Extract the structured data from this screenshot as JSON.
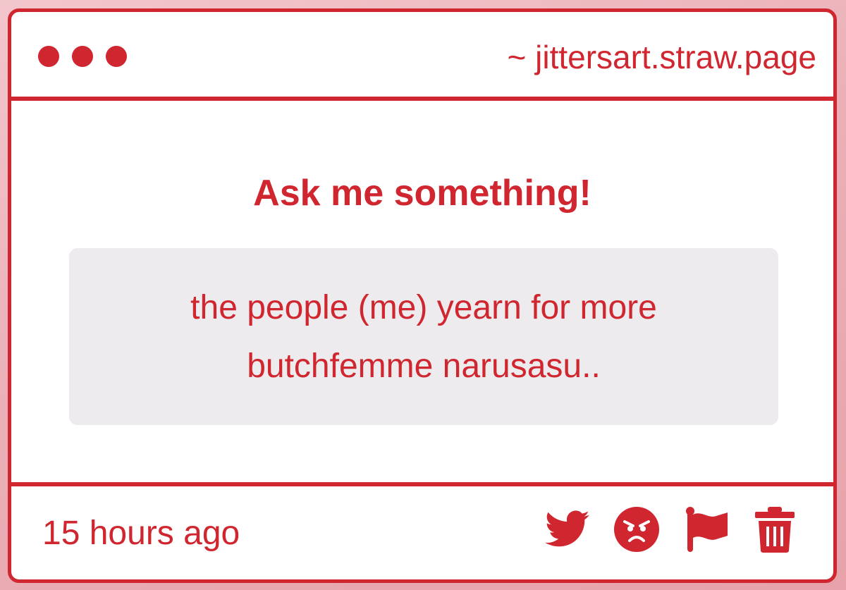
{
  "window": {
    "url": "~ jittersart.straw.page"
  },
  "main": {
    "heading": "Ask me something!",
    "question": "the people (me) yearn for more butchfemme narusasu.."
  },
  "footer": {
    "timestamp": "15 hours ago",
    "actions": [
      {
        "name": "share-twitter",
        "icon": "twitter-bird-icon"
      },
      {
        "name": "react",
        "icon": "angry-face-icon"
      },
      {
        "name": "report",
        "icon": "flag-icon"
      },
      {
        "name": "delete",
        "icon": "trash-icon"
      }
    ]
  },
  "colors": {
    "accent": "#d0262f",
    "question_background": "#edebed",
    "page_background": "#e9aab2"
  }
}
